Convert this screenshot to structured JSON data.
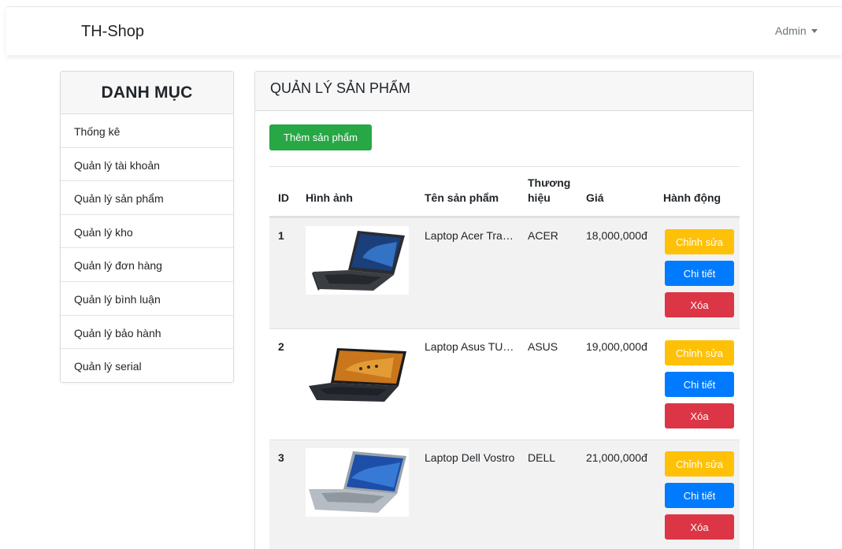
{
  "header": {
    "brand": "TH-Shop",
    "user_label": "Admin"
  },
  "sidebar": {
    "title": "DANH MỤC",
    "items": [
      {
        "label": "Thống kê"
      },
      {
        "label": "Quản lý tài khoản"
      },
      {
        "label": "Quản lý sản phẩm"
      },
      {
        "label": "Quản lý kho"
      },
      {
        "label": "Quản lý đơn hàng"
      },
      {
        "label": "Quản lý bình luận"
      },
      {
        "label": "Quản lý bảo hành"
      },
      {
        "label": "Quản lý serial"
      }
    ]
  },
  "main": {
    "title": "QUẢN LÝ SẢN PHẨM",
    "add_button": "Thêm sản phẩm",
    "columns": [
      "ID",
      "Hình ảnh",
      "Tên sản phẩm",
      "Thương hiệu",
      "Giá",
      "Hành động"
    ],
    "actions": {
      "edit": "Chỉnh sửa",
      "detail": "Chi tiết",
      "delete": "Xóa"
    },
    "rows": [
      {
        "id": "1",
        "name": "Laptop Acer Travelmate",
        "brand": "ACER",
        "price": "18,000,000đ"
      },
      {
        "id": "2",
        "name": "Laptop Asus TUF Gaming",
        "brand": "ASUS",
        "price": "19,000,000đ"
      },
      {
        "id": "3",
        "name": "Laptop Dell Vostro",
        "brand": "DELL",
        "price": "21,000,000đ"
      }
    ]
  },
  "colors": {
    "success": "#28a745",
    "warning": "#ffc107",
    "primary": "#007bff",
    "danger": "#dc3545"
  }
}
